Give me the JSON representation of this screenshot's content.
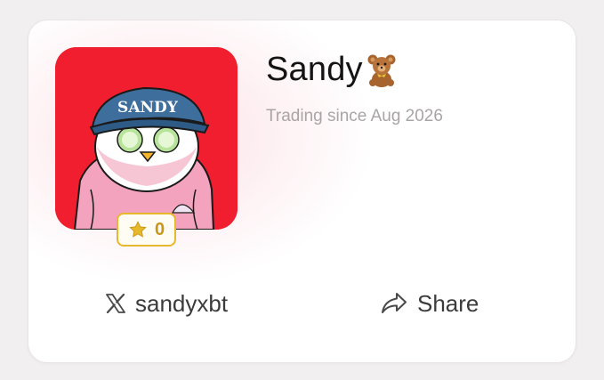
{
  "profile": {
    "name": "Sandy",
    "name_emoji_icon": "teddy-bear-icon",
    "since": "Trading since Aug 2026",
    "avatar_text": "SANDY",
    "star_count": "0"
  },
  "actions": {
    "x_handle": "sandyxbt",
    "share_label": "Share"
  },
  "colors": {
    "avatar_bg": "#f01e2e",
    "badge_border": "#e7b82a",
    "star": "#e7b82a",
    "card_glow": "#fad6de"
  }
}
